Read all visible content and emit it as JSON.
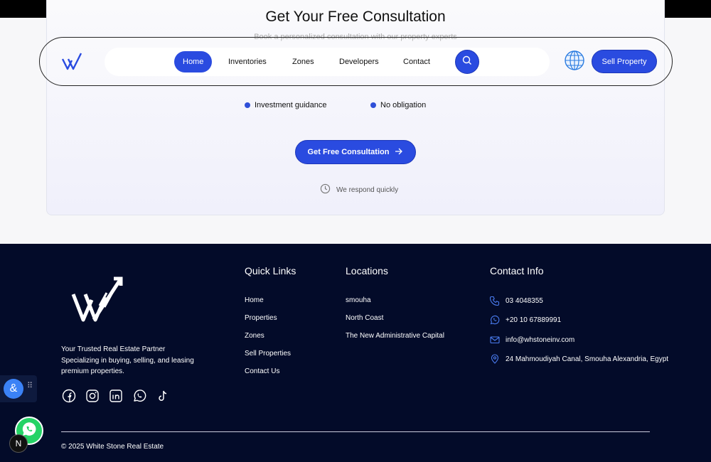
{
  "consultation": {
    "title": "Get Your Free Consultation",
    "subtitle": "Book a personalized consultation with our property experts",
    "features": [
      "Investment guidance",
      "No obligation"
    ],
    "cta_label": "Get Free Consultation",
    "respond_note": "We respond quickly"
  },
  "nav": {
    "links": [
      "Home",
      "Inventories",
      "Zones",
      "Developers",
      "Contact"
    ],
    "active": "Home",
    "sell_label": "Sell Property"
  },
  "footer": {
    "tagline_lines": [
      "Your Trusted Real Estate Partner",
      "Specializing in buying, selling, and leasing",
      "premium properties."
    ],
    "quick_links": {
      "title": "Quick Links",
      "items": [
        "Home",
        "Properties",
        "Zones",
        "Sell Properties",
        "Contact Us"
      ]
    },
    "locations": {
      "title": "Locations",
      "items": [
        "smouha",
        "North Coast",
        "The New Administrative Capital"
      ]
    },
    "contact": {
      "title": "Contact Info",
      "phone": "03 4048355",
      "whatsapp": "+20 10 67889991",
      "email": "info@whstoneinv.com",
      "address": "24 Mahmoudiyah Canal, Smouha Alexandria, Egypt"
    },
    "socials": [
      "facebook-icon",
      "instagram-icon",
      "linkedin-icon",
      "whatsapp-icon",
      "tiktok-icon"
    ],
    "copyright": "© 2025 White Stone Real Estate"
  },
  "widgets": {
    "accessibility_symbol": "&",
    "next_badge": "N"
  },
  "colors": {
    "accent": "#2a4be0",
    "footer_bg": "#030b29",
    "whatsapp": "#25d366"
  }
}
